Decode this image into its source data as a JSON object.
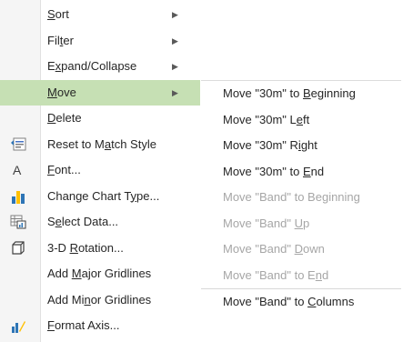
{
  "main_menu": [
    {
      "id": "sort",
      "pre": "",
      "ul": "S",
      "post": "ort",
      "has_submenu": true,
      "icon": ""
    },
    {
      "id": "filter",
      "pre": "Fil",
      "ul": "t",
      "post": "er",
      "has_submenu": true,
      "icon": ""
    },
    {
      "id": "expand-collapse",
      "pre": "E",
      "ul": "x",
      "post": "pand/Collapse",
      "has_submenu": true,
      "icon": ""
    },
    {
      "id": "move",
      "pre": "",
      "ul": "M",
      "post": "ove",
      "has_submenu": true,
      "active": true,
      "icon": ""
    },
    {
      "id": "delete",
      "pre": "",
      "ul": "D",
      "post": "elete",
      "has_submenu": false,
      "icon": ""
    },
    {
      "id": "reset-style",
      "pre": "Reset to M",
      "ul": "a",
      "post": "tch Style",
      "has_submenu": false,
      "icon": "reset-style-icon"
    },
    {
      "id": "font",
      "pre": "",
      "ul": "F",
      "post": "ont...",
      "has_submenu": false,
      "icon": "font-icon"
    },
    {
      "id": "change-chart-type",
      "pre": "Change Chart T",
      "ul": "y",
      "post": "pe...",
      "has_submenu": false,
      "icon": "chart-type-icon"
    },
    {
      "id": "select-data",
      "pre": "S",
      "ul": "e",
      "post": "lect Data...",
      "has_submenu": false,
      "icon": "select-data-icon"
    },
    {
      "id": "3d-rotation",
      "pre": "3-D ",
      "ul": "R",
      "post": "otation...",
      "has_submenu": false,
      "icon": "3d-rotation-icon"
    },
    {
      "id": "add-major-gridlines",
      "pre": "Add ",
      "ul": "M",
      "post": "ajor Gridlines",
      "has_submenu": false,
      "icon": ""
    },
    {
      "id": "add-minor-gridlines",
      "pre": "Add Mi",
      "ul": "n",
      "post": "or Gridlines",
      "has_submenu": false,
      "icon": ""
    },
    {
      "id": "format-axis",
      "pre": "",
      "ul": "F",
      "post": "ormat Axis...",
      "has_submenu": false,
      "icon": "format-axis-icon"
    }
  ],
  "submenu": [
    {
      "id": "move-30m-beginning",
      "pre": "Move \"30m\" to ",
      "ul": "B",
      "post": "eginning",
      "disabled": false
    },
    {
      "id": "move-30m-left",
      "pre": "Move \"30m\" L",
      "ul": "e",
      "post": "ft",
      "disabled": false
    },
    {
      "id": "move-30m-right",
      "pre": "Move \"30m\" R",
      "ul": "i",
      "post": "ght",
      "disabled": false
    },
    {
      "id": "move-30m-end",
      "pre": "Move \"30m\" to ",
      "ul": "E",
      "post": "nd",
      "disabled": false
    },
    {
      "id": "move-band-beginning",
      "pre": "Move \"Band\" to Beginning",
      "ul": "",
      "post": "",
      "disabled": true
    },
    {
      "id": "move-band-up",
      "pre": "Move \"Band\" ",
      "ul": "U",
      "post": "p",
      "disabled": true
    },
    {
      "id": "move-band-down",
      "pre": "Move \"Band\" ",
      "ul": "D",
      "post": "own",
      "disabled": true
    },
    {
      "id": "move-band-end",
      "pre": "Move \"Band\" to E",
      "ul": "n",
      "post": "d",
      "disabled": true
    },
    {
      "id": "move-band-columns",
      "pre": "Move \"Band\" to ",
      "ul": "C",
      "post": "olumns",
      "disabled": false,
      "separator_before": true
    }
  ],
  "colors": {
    "active_bg": "#c6e0b4",
    "disabled_text": "#a6a6a6",
    "text": "#262626"
  },
  "submenu_arrow": "▶"
}
